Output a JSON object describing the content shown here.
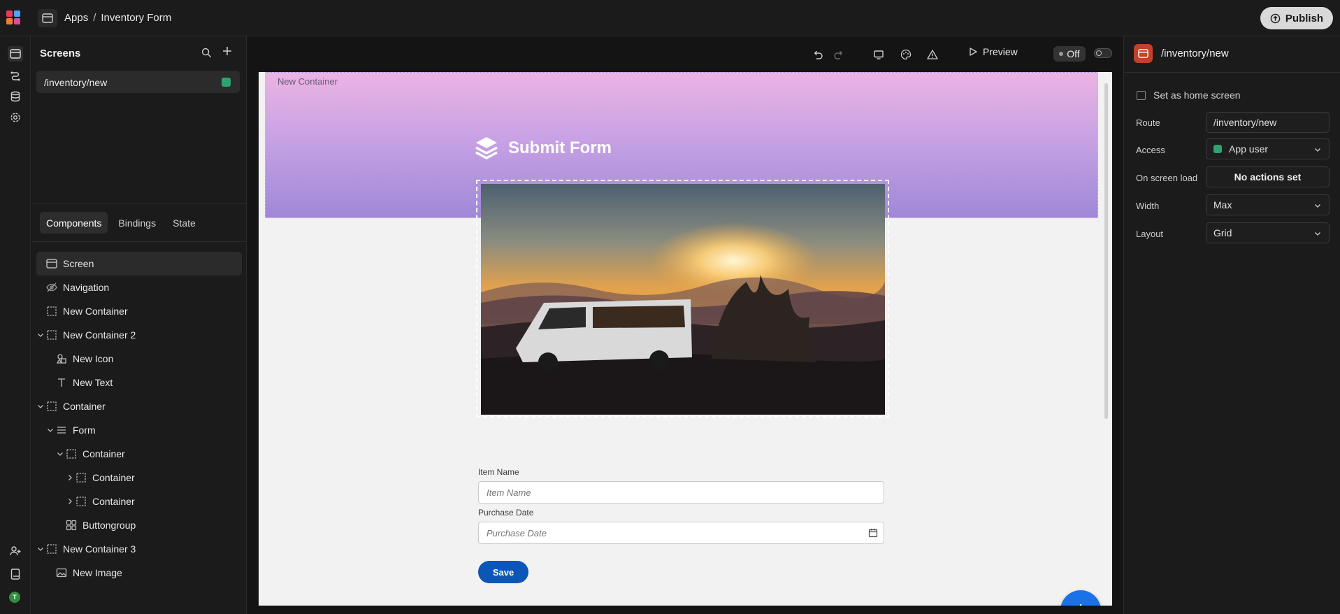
{
  "topbar": {
    "breadcrumb": [
      "Apps",
      "/",
      "Inventory Form"
    ],
    "publish_label": "Publish"
  },
  "screens": {
    "title": "Screens",
    "items": [
      {
        "label": "/inventory/new"
      }
    ]
  },
  "tabs": [
    "Components",
    "Bindings",
    "State"
  ],
  "tree": [
    {
      "label": "Screen"
    },
    {
      "label": "Navigation"
    },
    {
      "label": "New Container"
    },
    {
      "label": "New Container 2"
    },
    {
      "label": "New Icon"
    },
    {
      "label": "New Text"
    },
    {
      "label": "Container"
    },
    {
      "label": "Form"
    },
    {
      "label": "Container"
    },
    {
      "label": "Container"
    },
    {
      "label": "Container"
    },
    {
      "label": "Buttongroup"
    },
    {
      "label": "New Container 3"
    },
    {
      "label": "New Image"
    }
  ],
  "toolbar": {
    "preview_label": "Preview",
    "off_label": "Off"
  },
  "canvas": {
    "container_label": "New Container",
    "hero_title": "Submit Form",
    "form": {
      "item_name_label": "Item Name",
      "item_name_placeholder": "Item Name",
      "purchase_date_label": "Purchase Date",
      "purchase_date_placeholder": "Purchase Date",
      "save_label": "Save"
    }
  },
  "properties": {
    "route_title": "/inventory/new",
    "home_screen_label": "Set as home screen",
    "route_label": "Route",
    "route_value": "/inventory/new",
    "access_label": "Access",
    "access_value": "App user",
    "on_load_label": "On screen load",
    "on_load_value": "No actions set",
    "width_label": "Width",
    "width_value": "Max",
    "layout_label": "Layout",
    "layout_value": "Grid"
  },
  "user": {
    "initial": "T"
  },
  "colors": {
    "accent": "#0b56b6",
    "fab": "#1b72e8",
    "screen_badge": "#2ea36f",
    "screen_icon": "#c0422a"
  }
}
